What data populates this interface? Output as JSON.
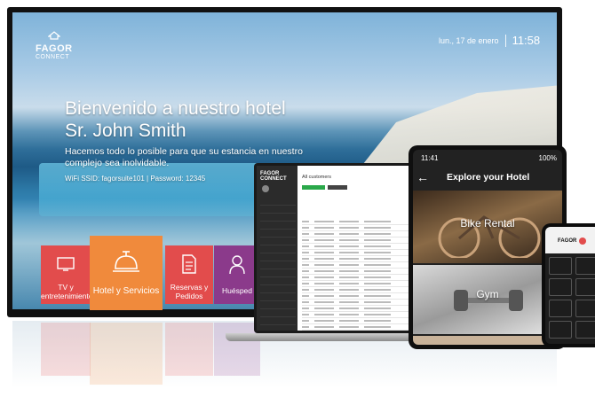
{
  "tv": {
    "brand": {
      "name": "FAGOR",
      "sub": "CONNECT"
    },
    "date": "lun., 17 de enero",
    "time": "11:58",
    "welcome_line1": "Bienvenido a nuestro hotel",
    "welcome_line2": "Sr. John Smith",
    "message": "Hacemos todo lo posible para que su estancia en nuestro complejo sea inolvidable.",
    "wifi": "WiFi SSID: fagorsuite101 | Password: 12345",
    "tiles": [
      {
        "label": "TV y entretenimiento",
        "color": "#e24c4c",
        "icon": "screen-icon"
      },
      {
        "label": "Hotel y Servicios",
        "color": "#f08a3c",
        "icon": "service-bell-icon"
      },
      {
        "label": "Reservas y Pedidos",
        "color": "#e24c4c",
        "icon": "document-icon"
      },
      {
        "label": "Huésped",
        "color": "#8b3a8b",
        "icon": "person-icon"
      }
    ]
  },
  "laptop": {
    "brand": "FAGOR CONNECT",
    "title": "All customers",
    "accent": "#2aa84a"
  },
  "tablet": {
    "status_time": "11:41",
    "status_battery": "100%",
    "title": "Explore your Hotel",
    "cards": [
      {
        "label": "Bike Rental"
      },
      {
        "label": "Gym"
      }
    ]
  },
  "phone": {
    "brand": "FAGOR"
  }
}
